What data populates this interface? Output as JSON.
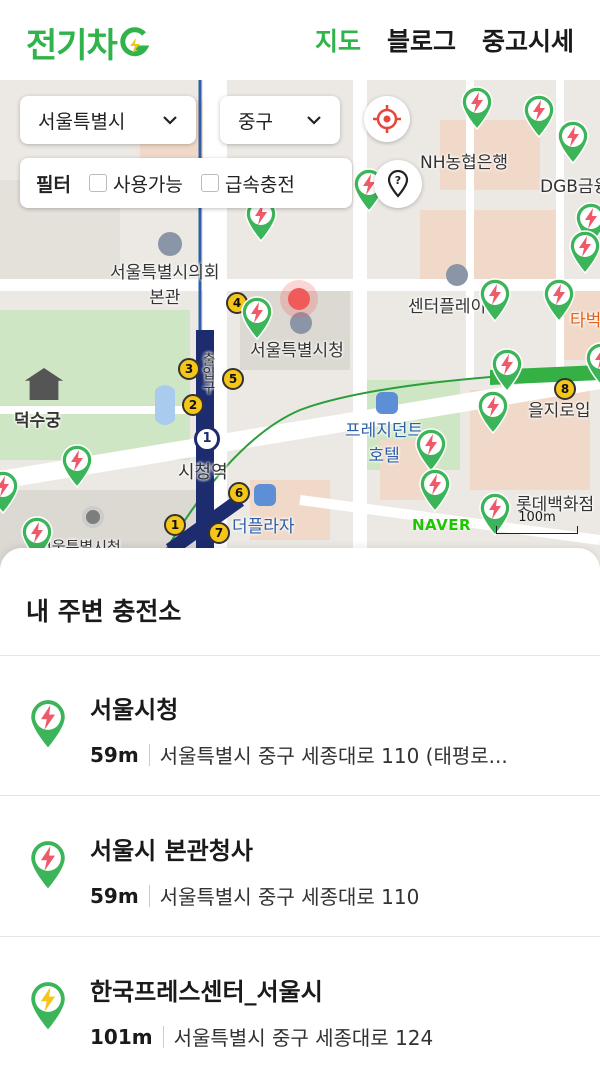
{
  "header": {
    "logo_text": "전기차",
    "logo_mark": "G",
    "nav": [
      {
        "label": "지도",
        "active": true
      },
      {
        "label": "블로그",
        "active": false
      },
      {
        "label": "중고시세",
        "active": false
      }
    ],
    "brand_color": "#2fb34a"
  },
  "map": {
    "city_select": {
      "value": "서울특별시",
      "icon": "chevron-down-icon"
    },
    "district_select": {
      "value": "중구",
      "icon": "chevron-down-icon"
    },
    "locate_icon": "crosshair-icon",
    "pin_icon": "location-pin-icon",
    "filter": {
      "label": "필터",
      "options": [
        {
          "label": "사용가능",
          "checked": false
        },
        {
          "label": "급속충전",
          "checked": false
        }
      ]
    },
    "labels": {
      "council": "서울특별시의회\n본관",
      "city_hall": "서울특별시청",
      "deoksugung": "덕수궁",
      "city_hall_station": "시청역",
      "press_hotel": "프레지던트\n호텔",
      "plaza": "더플라자",
      "nh_bank": "NH농협은행",
      "dgb": "DGB금융",
      "center_place": "센터플레이",
      "euljiro": "을지로입",
      "lotte": "롯데백화점",
      "tabak": "타벅",
      "city_hall_bottom": "서울특별시청",
      "exit_label": "출입구"
    },
    "attribution": "NAVER",
    "scale_label": "100m"
  },
  "sheet": {
    "title": "내 주변 충전소",
    "items": [
      {
        "name": "서울시청",
        "distance": "59m",
        "address": "서울특별시 중구 세종대로 110 (태평로..."
      },
      {
        "name": "서울시 본관청사",
        "distance": "59m",
        "address": "서울특별시 중구 세종대로 110"
      },
      {
        "name": "한국프레스센터_서울시",
        "distance": "101m",
        "address": "서울특별시 중구 세종대로 124"
      }
    ]
  }
}
